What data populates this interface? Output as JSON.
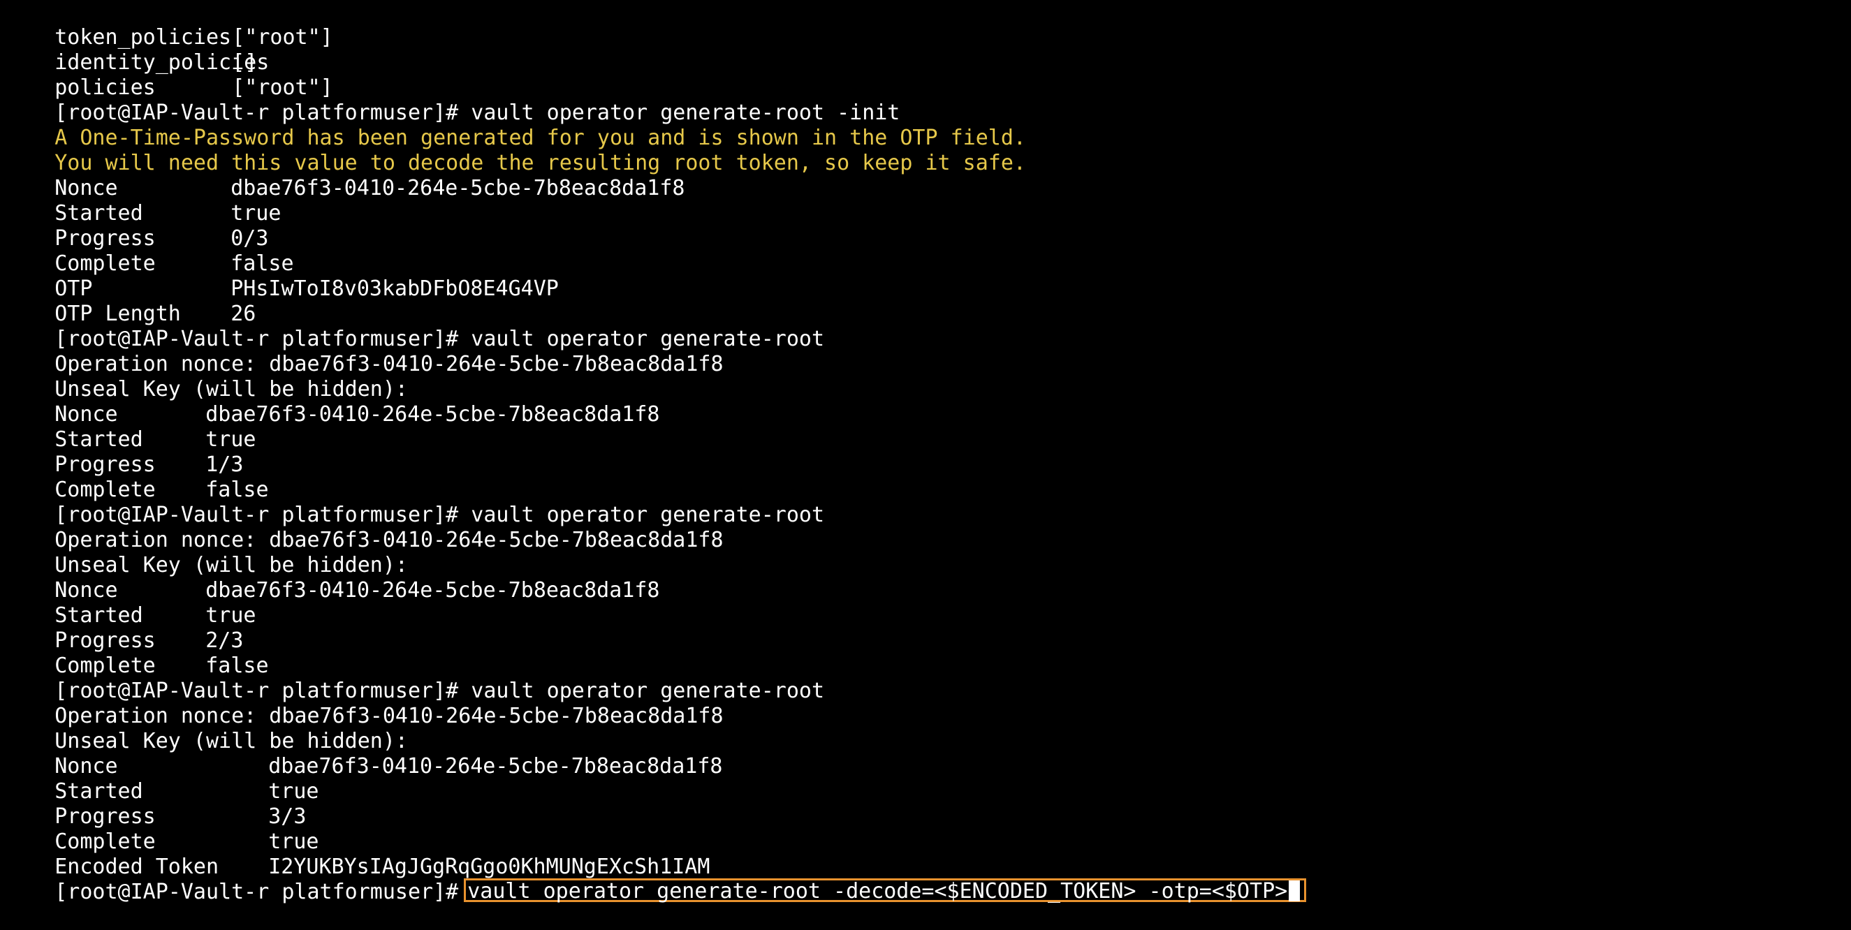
{
  "terminal": {
    "colors": {
      "background": "#000000",
      "text": "#ffffff",
      "warning_text": "#e6c84a",
      "highlight_box": "#e8922e"
    },
    "prompt": "[root@IAP-Vault-r platformuser]#",
    "token_info": [
      {
        "key": "token_policies",
        "value": "[\"root\"]"
      },
      {
        "key": "identity_policies",
        "value": "[]"
      },
      {
        "key": "policies",
        "value": "[\"root\"]"
      }
    ],
    "init": {
      "command": "vault operator generate-root -init",
      "warnings": [
        "A One-Time-Password has been generated for you and is shown in the OTP field.",
        "You will need this value to decode the resulting root token, so keep it safe."
      ],
      "status": [
        {
          "key": "Nonce",
          "value": "dbae76f3-0410-264e-5cbe-7b8eac8da1f8"
        },
        {
          "key": "Started",
          "value": "true"
        },
        {
          "key": "Progress",
          "value": "0/3"
        },
        {
          "key": "Complete",
          "value": "false"
        },
        {
          "key": "OTP",
          "value": "PHsIwToI8v03kabDFbO8E4G4VP"
        },
        {
          "key": "OTP Length",
          "value": "26"
        }
      ]
    },
    "steps": [
      {
        "command": "vault operator generate-root",
        "nonce_line": "Operation nonce: dbae76f3-0410-264e-5cbe-7b8eac8da1f8",
        "unseal_prompt": "Unseal Key (will be hidden):",
        "status": [
          {
            "key": "Nonce",
            "value": "dbae76f3-0410-264e-5cbe-7b8eac8da1f8"
          },
          {
            "key": "Started",
            "value": "true"
          },
          {
            "key": "Progress",
            "value": "1/3"
          },
          {
            "key": "Complete",
            "value": "false"
          }
        ]
      },
      {
        "command": "vault operator generate-root",
        "nonce_line": "Operation nonce: dbae76f3-0410-264e-5cbe-7b8eac8da1f8",
        "unseal_prompt": "Unseal Key (will be hidden):",
        "status": [
          {
            "key": "Nonce",
            "value": "dbae76f3-0410-264e-5cbe-7b8eac8da1f8"
          },
          {
            "key": "Started",
            "value": "true"
          },
          {
            "key": "Progress",
            "value": "2/3"
          },
          {
            "key": "Complete",
            "value": "false"
          }
        ]
      },
      {
        "command": "vault operator generate-root",
        "nonce_line": "Operation nonce: dbae76f3-0410-264e-5cbe-7b8eac8da1f8",
        "unseal_prompt": "Unseal Key (will be hidden):",
        "status": [
          {
            "key": "Nonce",
            "value": "dbae76f3-0410-264e-5cbe-7b8eac8da1f8"
          },
          {
            "key": "Started",
            "value": "true"
          },
          {
            "key": "Progress",
            "value": "3/3"
          },
          {
            "key": "Complete",
            "value": "true"
          },
          {
            "key": "Encoded Token",
            "value": "I2YUKBYsIAgJGgRqGgo0KhMUNgEXcSh1IAM"
          }
        ]
      }
    ],
    "current_input": "vault operator generate-root -decode=<$ENCODED_TOKEN> -otp=<$OTP>"
  }
}
